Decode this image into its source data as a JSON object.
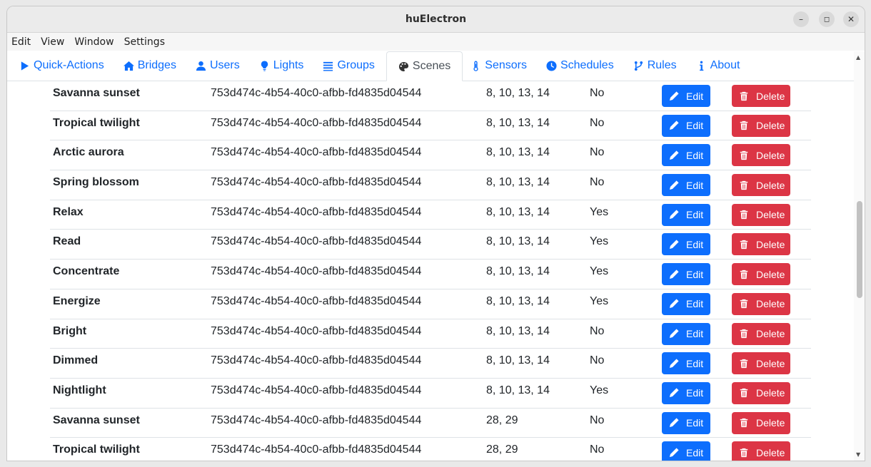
{
  "window": {
    "title": "huElectron"
  },
  "menu": [
    "Edit",
    "View",
    "Window",
    "Settings"
  ],
  "tabs": [
    {
      "label": "Quick-Actions",
      "icon": "play-icon",
      "active": false
    },
    {
      "label": "Bridges",
      "icon": "home-icon",
      "active": false
    },
    {
      "label": "Users",
      "icon": "user-icon",
      "active": false
    },
    {
      "label": "Lights",
      "icon": "lightbulb-icon",
      "active": false
    },
    {
      "label": "Groups",
      "icon": "list-icon",
      "active": false
    },
    {
      "label": "Scenes",
      "icon": "palette-icon",
      "active": true
    },
    {
      "label": "Sensors",
      "icon": "thermometer-icon",
      "active": false
    },
    {
      "label": "Schedules",
      "icon": "clock-icon",
      "active": false
    },
    {
      "label": "Rules",
      "icon": "branch-icon",
      "active": false
    },
    {
      "label": "About",
      "icon": "info-icon",
      "active": false
    }
  ],
  "buttons": {
    "edit": "Edit",
    "delete": "Delete"
  },
  "scenes": [
    {
      "name": "Savanna sunset",
      "id": "753d474c-4b54-40c0-afbb-fd4835d04544",
      "lights": "8, 10, 13, 14",
      "recycle": "No"
    },
    {
      "name": "Tropical twilight",
      "id": "753d474c-4b54-40c0-afbb-fd4835d04544",
      "lights": "8, 10, 13, 14",
      "recycle": "No"
    },
    {
      "name": "Arctic aurora",
      "id": "753d474c-4b54-40c0-afbb-fd4835d04544",
      "lights": "8, 10, 13, 14",
      "recycle": "No"
    },
    {
      "name": "Spring blossom",
      "id": "753d474c-4b54-40c0-afbb-fd4835d04544",
      "lights": "8, 10, 13, 14",
      "recycle": "No"
    },
    {
      "name": "Relax",
      "id": "753d474c-4b54-40c0-afbb-fd4835d04544",
      "lights": "8, 10, 13, 14",
      "recycle": "Yes"
    },
    {
      "name": "Read",
      "id": "753d474c-4b54-40c0-afbb-fd4835d04544",
      "lights": "8, 10, 13, 14",
      "recycle": "Yes"
    },
    {
      "name": "Concentrate",
      "id": "753d474c-4b54-40c0-afbb-fd4835d04544",
      "lights": "8, 10, 13, 14",
      "recycle": "Yes"
    },
    {
      "name": "Energize",
      "id": "753d474c-4b54-40c0-afbb-fd4835d04544",
      "lights": "8, 10, 13, 14",
      "recycle": "Yes"
    },
    {
      "name": "Bright",
      "id": "753d474c-4b54-40c0-afbb-fd4835d04544",
      "lights": "8, 10, 13, 14",
      "recycle": "No"
    },
    {
      "name": "Dimmed",
      "id": "753d474c-4b54-40c0-afbb-fd4835d04544",
      "lights": "8, 10, 13, 14",
      "recycle": "No"
    },
    {
      "name": "Nightlight",
      "id": "753d474c-4b54-40c0-afbb-fd4835d04544",
      "lights": "8, 10, 13, 14",
      "recycle": "Yes"
    },
    {
      "name": "Savanna sunset",
      "id": "753d474c-4b54-40c0-afbb-fd4835d04544",
      "lights": "28, 29",
      "recycle": "No"
    },
    {
      "name": "Tropical twilight",
      "id": "753d474c-4b54-40c0-afbb-fd4835d04544",
      "lights": "28, 29",
      "recycle": "No"
    }
  ]
}
